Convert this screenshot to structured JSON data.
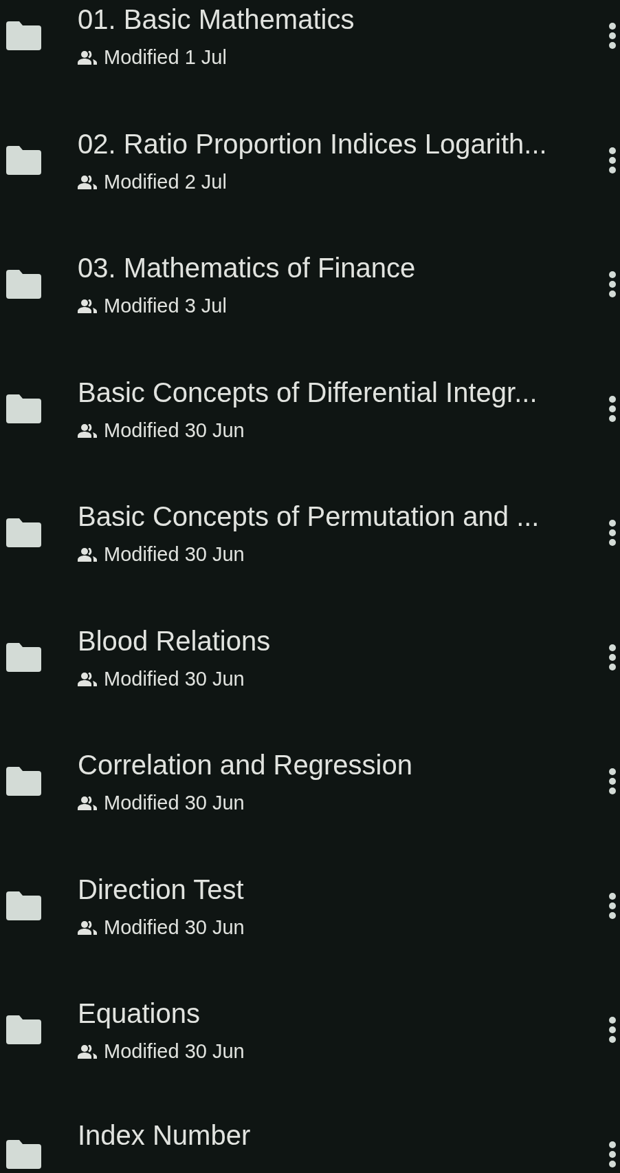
{
  "files": [
    {
      "name": "01. Basic Mathematics",
      "modified": "Modified 1 Jul"
    },
    {
      "name": "02. Ratio Proportion Indices Logarith...",
      "modified": "Modified 2 Jul"
    },
    {
      "name": "03. Mathematics of Finance",
      "modified": "Modified 3 Jul"
    },
    {
      "name": "Basic Concepts of Differential Integr...",
      "modified": "Modified 30 Jun"
    },
    {
      "name": "Basic Concepts of Permutation and ...",
      "modified": "Modified 30 Jun"
    },
    {
      "name": "Blood Relations",
      "modified": "Modified 30 Jun"
    },
    {
      "name": "Correlation and Regression",
      "modified": "Modified 30 Jun"
    },
    {
      "name": "Direction Test",
      "modified": "Modified 30 Jun"
    },
    {
      "name": "Equations",
      "modified": "Modified 30 Jun"
    },
    {
      "name": "Index Number"
    }
  ]
}
